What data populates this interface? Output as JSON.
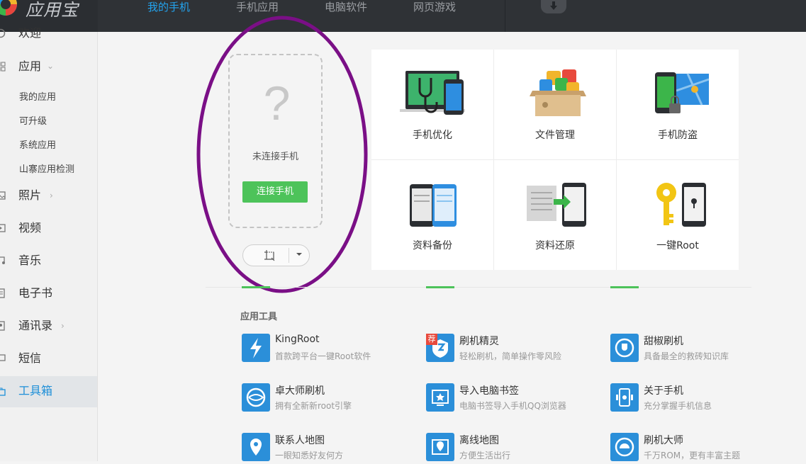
{
  "app": {
    "name": "应用宝"
  },
  "nav": {
    "tabs": [
      "我的手机",
      "手机应用",
      "电脑软件",
      "网页游戏"
    ],
    "active_index": 0
  },
  "sidebar": {
    "items": [
      {
        "label": "欢迎",
        "icon": "welcome-icon"
      },
      {
        "label": "应用",
        "icon": "grid-icon",
        "expanded": true
      },
      {
        "label": "照片",
        "icon": "photo-icon"
      },
      {
        "label": "视频",
        "icon": "video-icon"
      },
      {
        "label": "音乐",
        "icon": "music-icon"
      },
      {
        "label": "电子书",
        "icon": "book-icon"
      },
      {
        "label": "通讯录",
        "icon": "contacts-icon"
      },
      {
        "label": "短信",
        "icon": "sms-icon"
      },
      {
        "label": "工具箱",
        "icon": "toolbox-icon",
        "active": true
      }
    ],
    "sub_items": [
      "我的应用",
      "可升级",
      "系统应用",
      "山寨应用检测"
    ]
  },
  "phone": {
    "status": "未连接手机",
    "connect_label": "连接手机",
    "placeholder_glyph": "?"
  },
  "tools": [
    {
      "label": "手机优化"
    },
    {
      "label": "文件管理"
    },
    {
      "label": "手机防盗"
    },
    {
      "label": "资料备份"
    },
    {
      "label": "资料还原"
    },
    {
      "label": "一键Root"
    }
  ],
  "app_tools": {
    "title": "应用工具",
    "items": [
      {
        "name": "KingRoot",
        "desc": "首款跨平台一键Root软件"
      },
      {
        "name": "刷机精灵",
        "desc": "轻松刷机，简单操作零风险",
        "badge": "荐"
      },
      {
        "name": "甜椒刷机",
        "desc": "具备最全的救砖知识库"
      },
      {
        "name": "卓大师刷机",
        "desc": "拥有全新新root引擎"
      },
      {
        "name": "导入电脑书签",
        "desc": "电脑书签导入手机QQ浏览器"
      },
      {
        "name": "关于手机",
        "desc": "充分掌握手机信息"
      },
      {
        "name": "联系人地图",
        "desc": "一眼知悉好友何方"
      },
      {
        "name": "离线地图",
        "desc": "方便生活出行"
      },
      {
        "name": "刷机大师",
        "desc": "千万ROM，更有丰富主题"
      }
    ]
  },
  "colors": {
    "accent": "#23a3ee",
    "green": "#4dc35a",
    "annotation": "#7a0f86",
    "topbar": "#2f3236"
  }
}
